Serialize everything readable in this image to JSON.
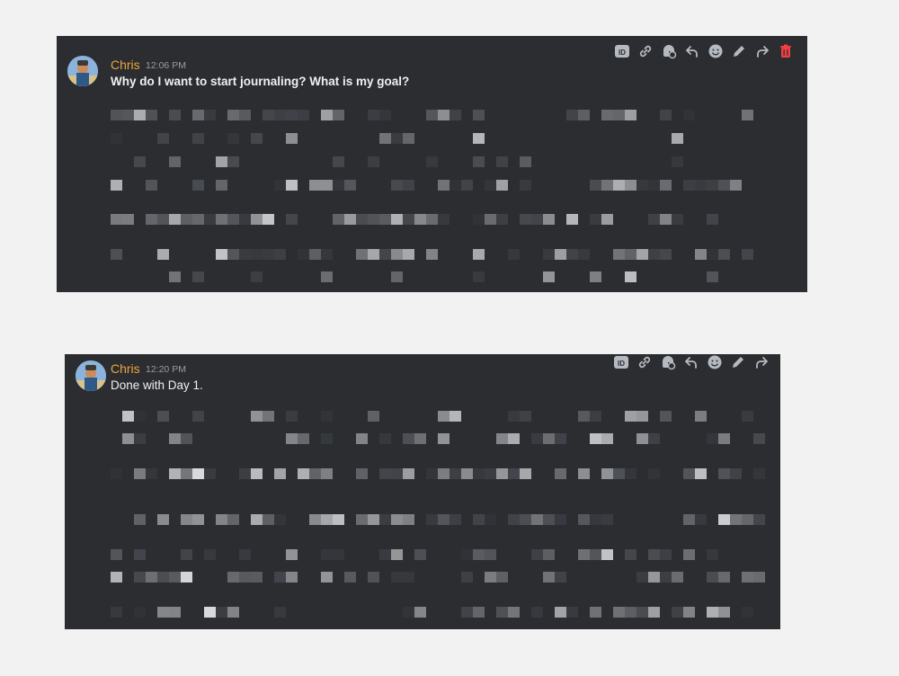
{
  "messages": [
    {
      "author": "Chris",
      "timestamp": "12:06 PM",
      "text": "Why do I want to start journaling? What is my goal?",
      "bold": true
    },
    {
      "author": "Chris",
      "timestamp": "12:20 PM",
      "text": "Done with Day 1.",
      "bold": false
    }
  ],
  "toolbar_icons": [
    "id-icon",
    "link-icon",
    "thread-reply-icon",
    "reply-icon",
    "emoji-icon",
    "edit-icon",
    "forward-icon",
    "delete-icon"
  ],
  "colors": {
    "page_background": "#f2f2f2",
    "panel_background": "#2b2d31",
    "author_color": "#f0a33b",
    "timestamp_color": "#9a9ca3",
    "message_text": "#eef0f2",
    "icon_color": "#b5bac1",
    "delete_color": "#f23f43"
  },
  "pixelated_body_note_visible": false
}
